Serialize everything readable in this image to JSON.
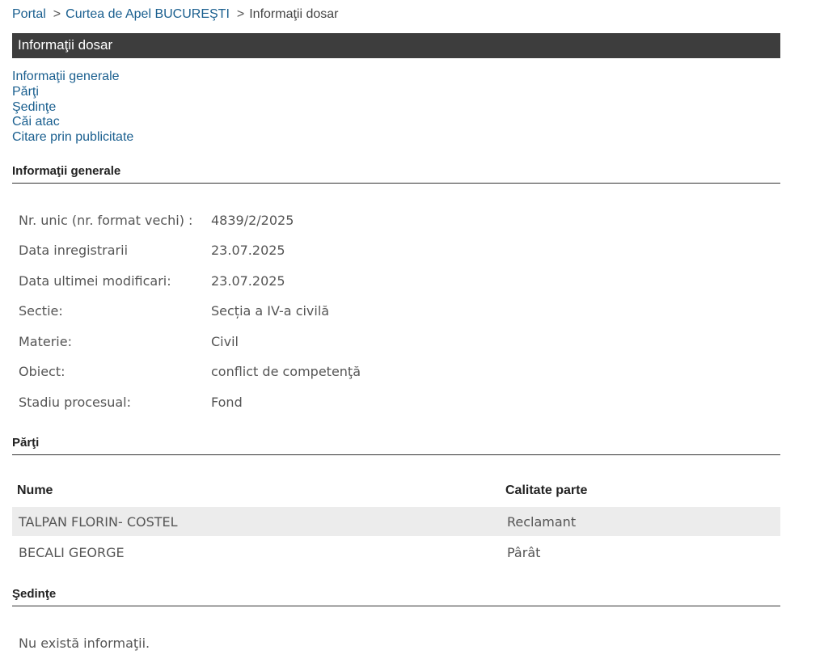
{
  "breadcrumb": {
    "items": [
      {
        "label": "Portal"
      },
      {
        "label": "Curtea de Apel BUCUREŞTI"
      },
      {
        "label": "Informaţii dosar"
      }
    ],
    "separator": ">"
  },
  "page_title": "Informaţii dosar",
  "nav_links": [
    {
      "label": "Informaţii generale"
    },
    {
      "label": "Părţi"
    },
    {
      "label": "Şedinţe"
    },
    {
      "label": "Căi atac"
    },
    {
      "label": "Citare prin publicitate"
    }
  ],
  "general_info": {
    "heading": "Informaţii generale",
    "rows": [
      {
        "label": "Nr. unic (nr. format vechi) :",
        "value": "4839/2/2025"
      },
      {
        "label": "Data inregistrarii",
        "value": "23.07.2025"
      },
      {
        "label": "Data ultimei modificari:",
        "value": "23.07.2025"
      },
      {
        "label": "Sectie:",
        "value": "Secția a IV-a civilă"
      },
      {
        "label": "Materie:",
        "value": "Civil"
      },
      {
        "label": "Obiect:",
        "value": "conflict de competenţă"
      },
      {
        "label": "Stadiu procesual:",
        "value": "Fond"
      }
    ]
  },
  "parti": {
    "heading": "Părţi",
    "columns": [
      "Nume",
      "Calitate parte"
    ],
    "rows": [
      {
        "nume": "TALPAN FLORIN- COSTEL",
        "calitate": "Reclamant"
      },
      {
        "nume": "BECALI GEORGE",
        "calitate": "Pârât"
      }
    ]
  },
  "sedinte": {
    "heading": "Şedinţe",
    "empty_message": "Nu există informaţii."
  },
  "colors": {
    "link": "#1a5f8f",
    "title_bar": "#3d3d3d",
    "row_alt": "#ececec"
  }
}
